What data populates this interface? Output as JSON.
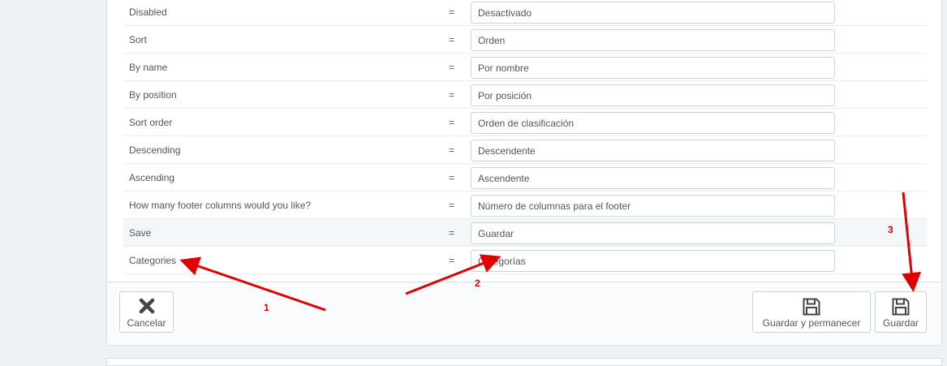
{
  "translations": [
    {
      "source": "Disabled",
      "value": "Desactivado"
    },
    {
      "source": "Sort",
      "value": "Orden"
    },
    {
      "source": "By name",
      "value": "Por nombre"
    },
    {
      "source": "By position",
      "value": "Por posición"
    },
    {
      "source": "Sort order",
      "value": "Orden de clasificación"
    },
    {
      "source": "Descending",
      "value": "Descendente"
    },
    {
      "source": "Ascending",
      "value": "Ascendente"
    },
    {
      "source": "How many footer columns would you like?",
      "value": "Número de columnas para el footer"
    },
    {
      "source": "Save",
      "value": "Guardar"
    },
    {
      "source": "Categories",
      "value": "Categorías"
    }
  ],
  "equals_sign": "=",
  "footer": {
    "cancel_label": "Cancelar",
    "save_stay_label": "Guardar y permanecer",
    "save_label": "Guardar",
    "cancel_icon": "close-icon",
    "save_icon": "floppy-disk-icon"
  },
  "annotations": {
    "arrow_1_label": "1",
    "arrow_2_label": "2",
    "arrow_3_label": "3",
    "color": "#e00000"
  },
  "colors": {
    "page_background": "#eef1f4",
    "panel_background": "#ffffff",
    "highlight_row": "#f4f7fa",
    "input_border": "#c7d6db",
    "text": "#555555"
  }
}
